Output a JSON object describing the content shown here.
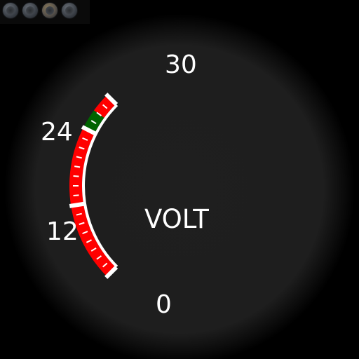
{
  "gauge": {
    "unit_label": "VOLT",
    "scale_labels": {
      "max": "30",
      "upper": "24",
      "lower": "12",
      "min": "0"
    },
    "scale_min": 0,
    "scale_max": 30,
    "bands": [
      {
        "from": 0,
        "to": 12,
        "color": "#ff0000"
      },
      {
        "from": 12,
        "to": 24,
        "color": "#ff0000"
      },
      {
        "from": 24,
        "to": 27,
        "color": "#006400"
      },
      {
        "from": 27,
        "to": 30,
        "color": "#ff0000"
      }
    ],
    "face_color": "#1e1e1e",
    "background_color": "#000000",
    "arc_color": "#ffffff"
  },
  "header": {
    "screws": [
      {
        "icon": "screw-icon"
      },
      {
        "icon": "screw-icon"
      },
      {
        "icon": "screw-icon"
      },
      {
        "icon": "screw-icon"
      }
    ]
  }
}
